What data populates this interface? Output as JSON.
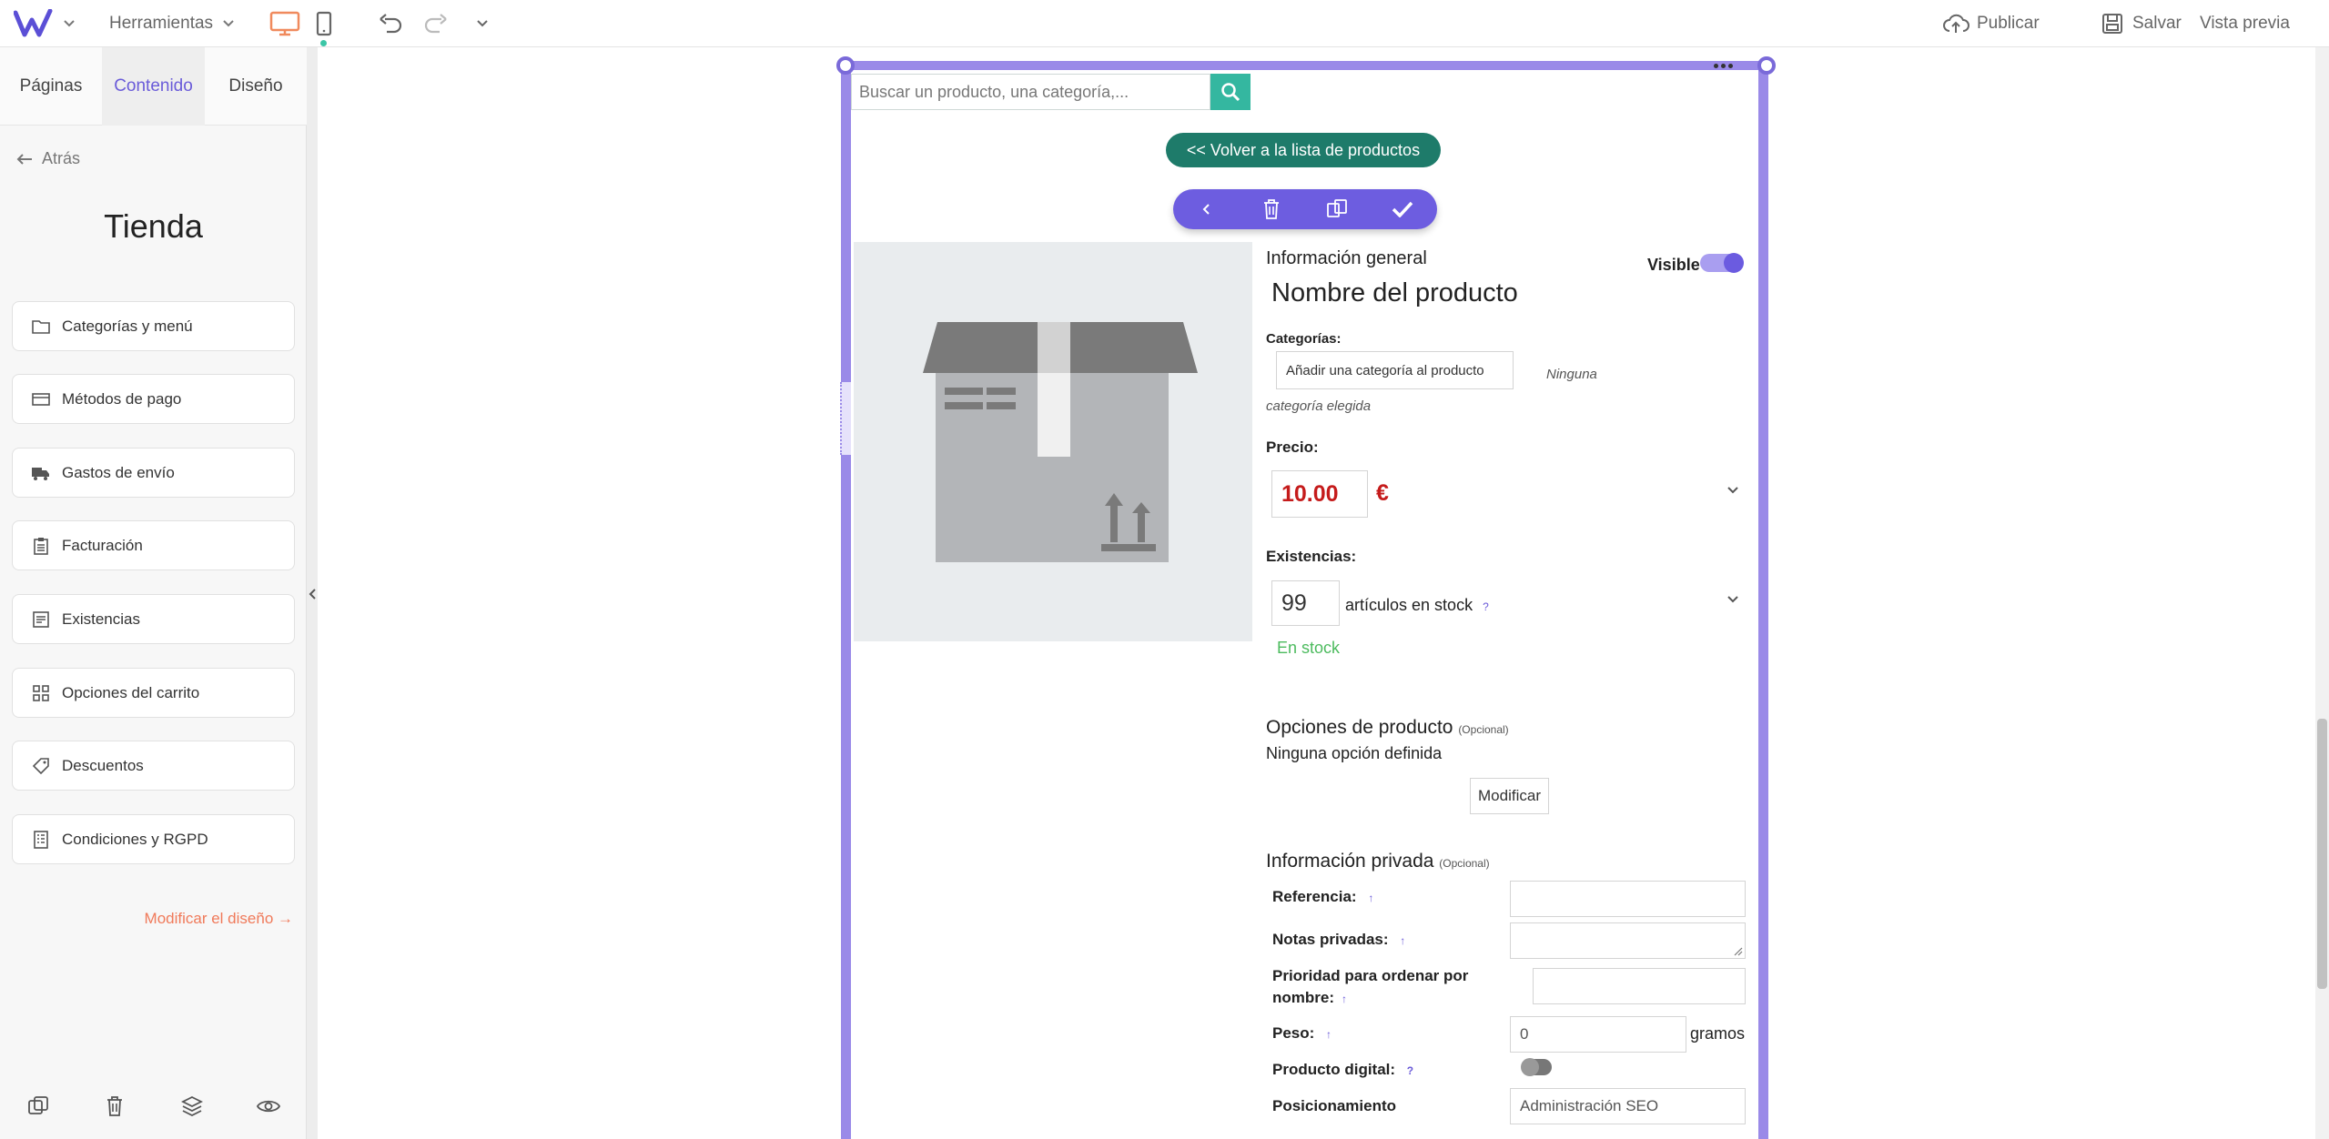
{
  "topbar": {
    "tools_label": "Herramientas",
    "publish_label": "Publicar",
    "save_label": "Salvar",
    "preview_label": "Vista previa",
    "accent_color": "#f08a5d"
  },
  "sidebar": {
    "tabs": [
      {
        "label": "Páginas"
      },
      {
        "label": "Contenido"
      },
      {
        "label": "Diseño"
      }
    ],
    "back_label": "Atrás",
    "title": "Tienda",
    "items": [
      {
        "label": "Categorías y menú",
        "icon": "folder-icon"
      },
      {
        "label": "Métodos de pago",
        "icon": "card-icon"
      },
      {
        "label": "Gastos de envío",
        "icon": "truck-icon"
      },
      {
        "label": "Facturación",
        "icon": "clipboard-icon"
      },
      {
        "label": "Existencias",
        "icon": "stock-icon"
      },
      {
        "label": "Opciones del carrito",
        "icon": "grid-icon"
      },
      {
        "label": "Descuentos",
        "icon": "tag-icon"
      },
      {
        "label": "Condiciones y RGPD",
        "icon": "document-icon"
      }
    ],
    "modify_design_label": "Modificar el diseño →"
  },
  "editor": {
    "search_placeholder": "Buscar un producto, una categoría,...",
    "back_to_list_label": "<< Volver a la lista de productos",
    "general_info_title": "Información general",
    "visible_label": "Visible",
    "product_name": "Nombre del producto",
    "categories_label": "Categorías:",
    "add_category_label": "Añadir una categoría al producto",
    "no_category_label": "Ninguna categoría elegida",
    "price_label": "Precio:",
    "price_value": "10.00",
    "currency": "€",
    "stock_label": "Existencias:",
    "stock_value": "99",
    "stock_unit": "artículos en stock",
    "help_mark": "?",
    "in_stock_label": "En stock",
    "product_options_title": "Opciones de producto",
    "optional_label": "(Opcional)",
    "no_option_label": "Ninguna opción definida",
    "modify_label": "Modificar",
    "private_info_title": "Información privada",
    "reference_label": "Referencia:",
    "private_notes_label": "Notas privadas:",
    "priority_label_1": "Prioridad para ordenar por",
    "priority_label_2": "nombre:",
    "weight_label": "Peso:",
    "weight_value": "0",
    "weight_unit": "gramos",
    "digital_label": "Producto digital:",
    "seo_label": "Posicionamiento",
    "seo_button_label": "Administración SEO",
    "small_mark": "↑"
  }
}
